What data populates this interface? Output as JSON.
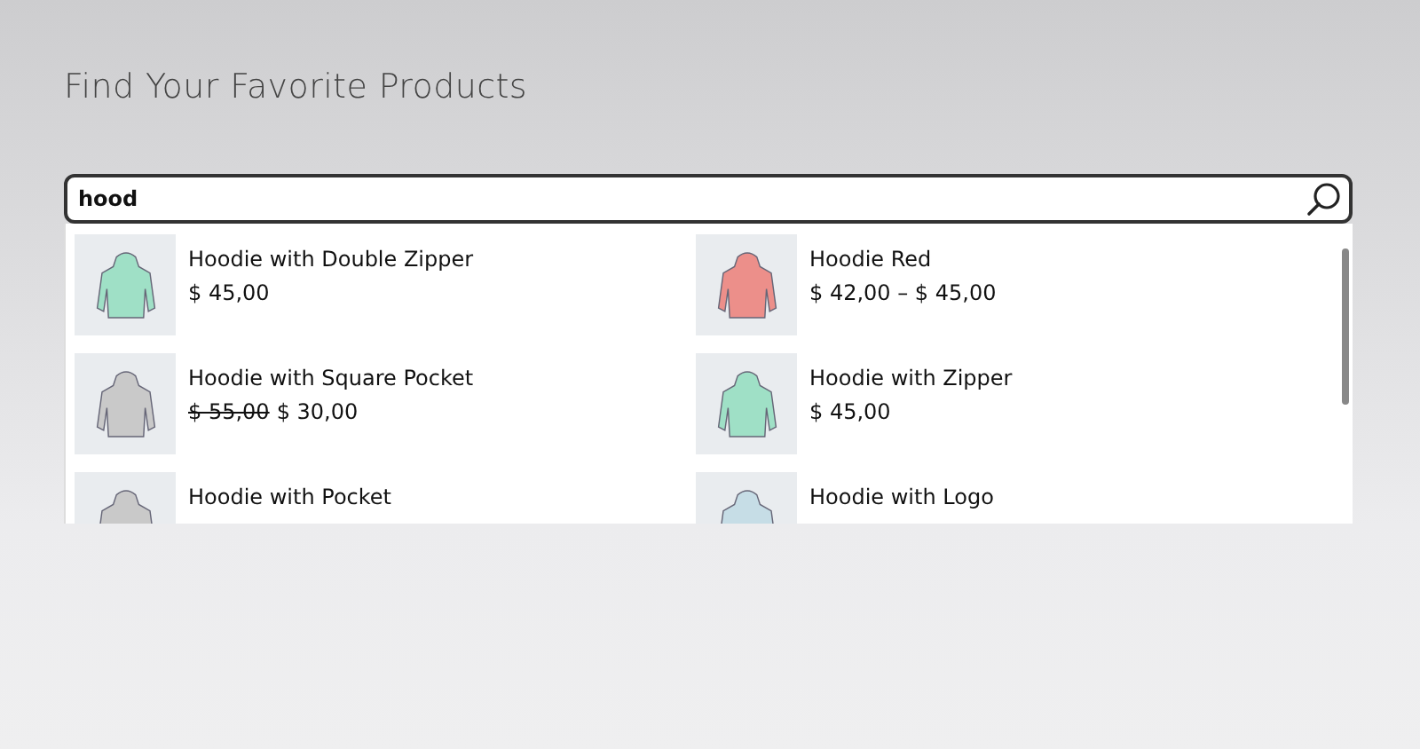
{
  "title": "Find Your Favorite Products",
  "search": {
    "value": "hood"
  },
  "results": [
    {
      "name": "Hoodie with Double Zipper",
      "price": "$ 45,00",
      "color": "#9fe0c6"
    },
    {
      "name": "Hoodie Red",
      "price": "$ 42,00 – $ 45,00",
      "color": "#ec8f8a"
    },
    {
      "name": "Hoodie with Square Pocket",
      "old_price": "$ 55,00",
      "price": "$ 30,00",
      "color": "#c9c9c9"
    },
    {
      "name": "Hoodie with Zipper",
      "price": "$ 45,00",
      "color": "#9fe0c6"
    },
    {
      "name": "Hoodie with Pocket",
      "color": "#c9c9c9"
    },
    {
      "name": "Hoodie with Logo",
      "color": "#c6dde6"
    }
  ]
}
